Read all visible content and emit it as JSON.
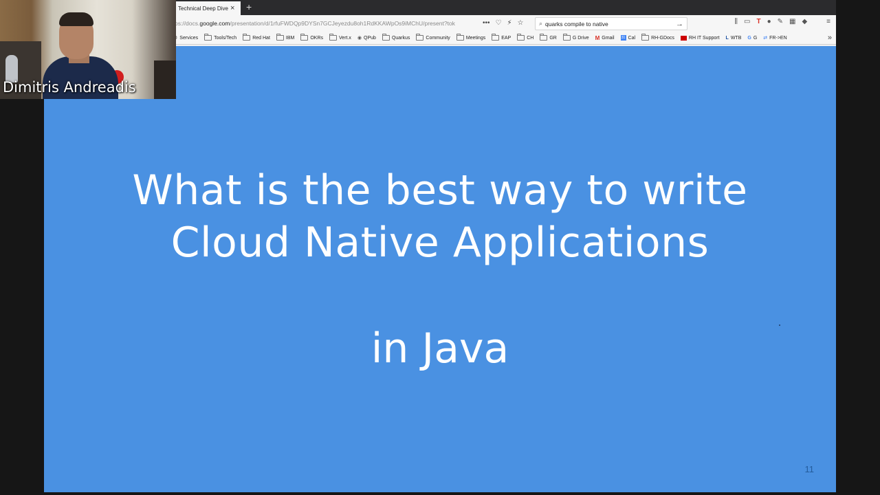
{
  "browser": {
    "tab_title": "Technical Deep Dive",
    "url_prefix": "ps://docs.",
    "url_domain": "google.com",
    "url_rest": "/presentation/d/1rfuFWDQp9DYSn7GCJeyezdu8oh1RdKKAWpOs9iMChU/present?tok",
    "search_text": "quarks compile to native",
    "bookmarks": [
      "Services",
      "Tools/Tech",
      "Red Hat",
      "IBM",
      "OKRs",
      "Vert.x",
      "QPub",
      "Quarkus",
      "Community",
      "Meetings",
      "EAP",
      "CH",
      "GR",
      "G Drive",
      "Gmail",
      "Cal",
      "RH-GDocs",
      "RH IT Support",
      "WTB",
      "G",
      "FR->EN"
    ]
  },
  "slide": {
    "title_line1": "What is the best way to write",
    "title_line2": "Cloud Native Applications",
    "subtitle": "in Java",
    "page_number": "11",
    "background": "#4a91e2"
  },
  "webcam": {
    "speaker_name": "Dimitris Andreadis"
  }
}
